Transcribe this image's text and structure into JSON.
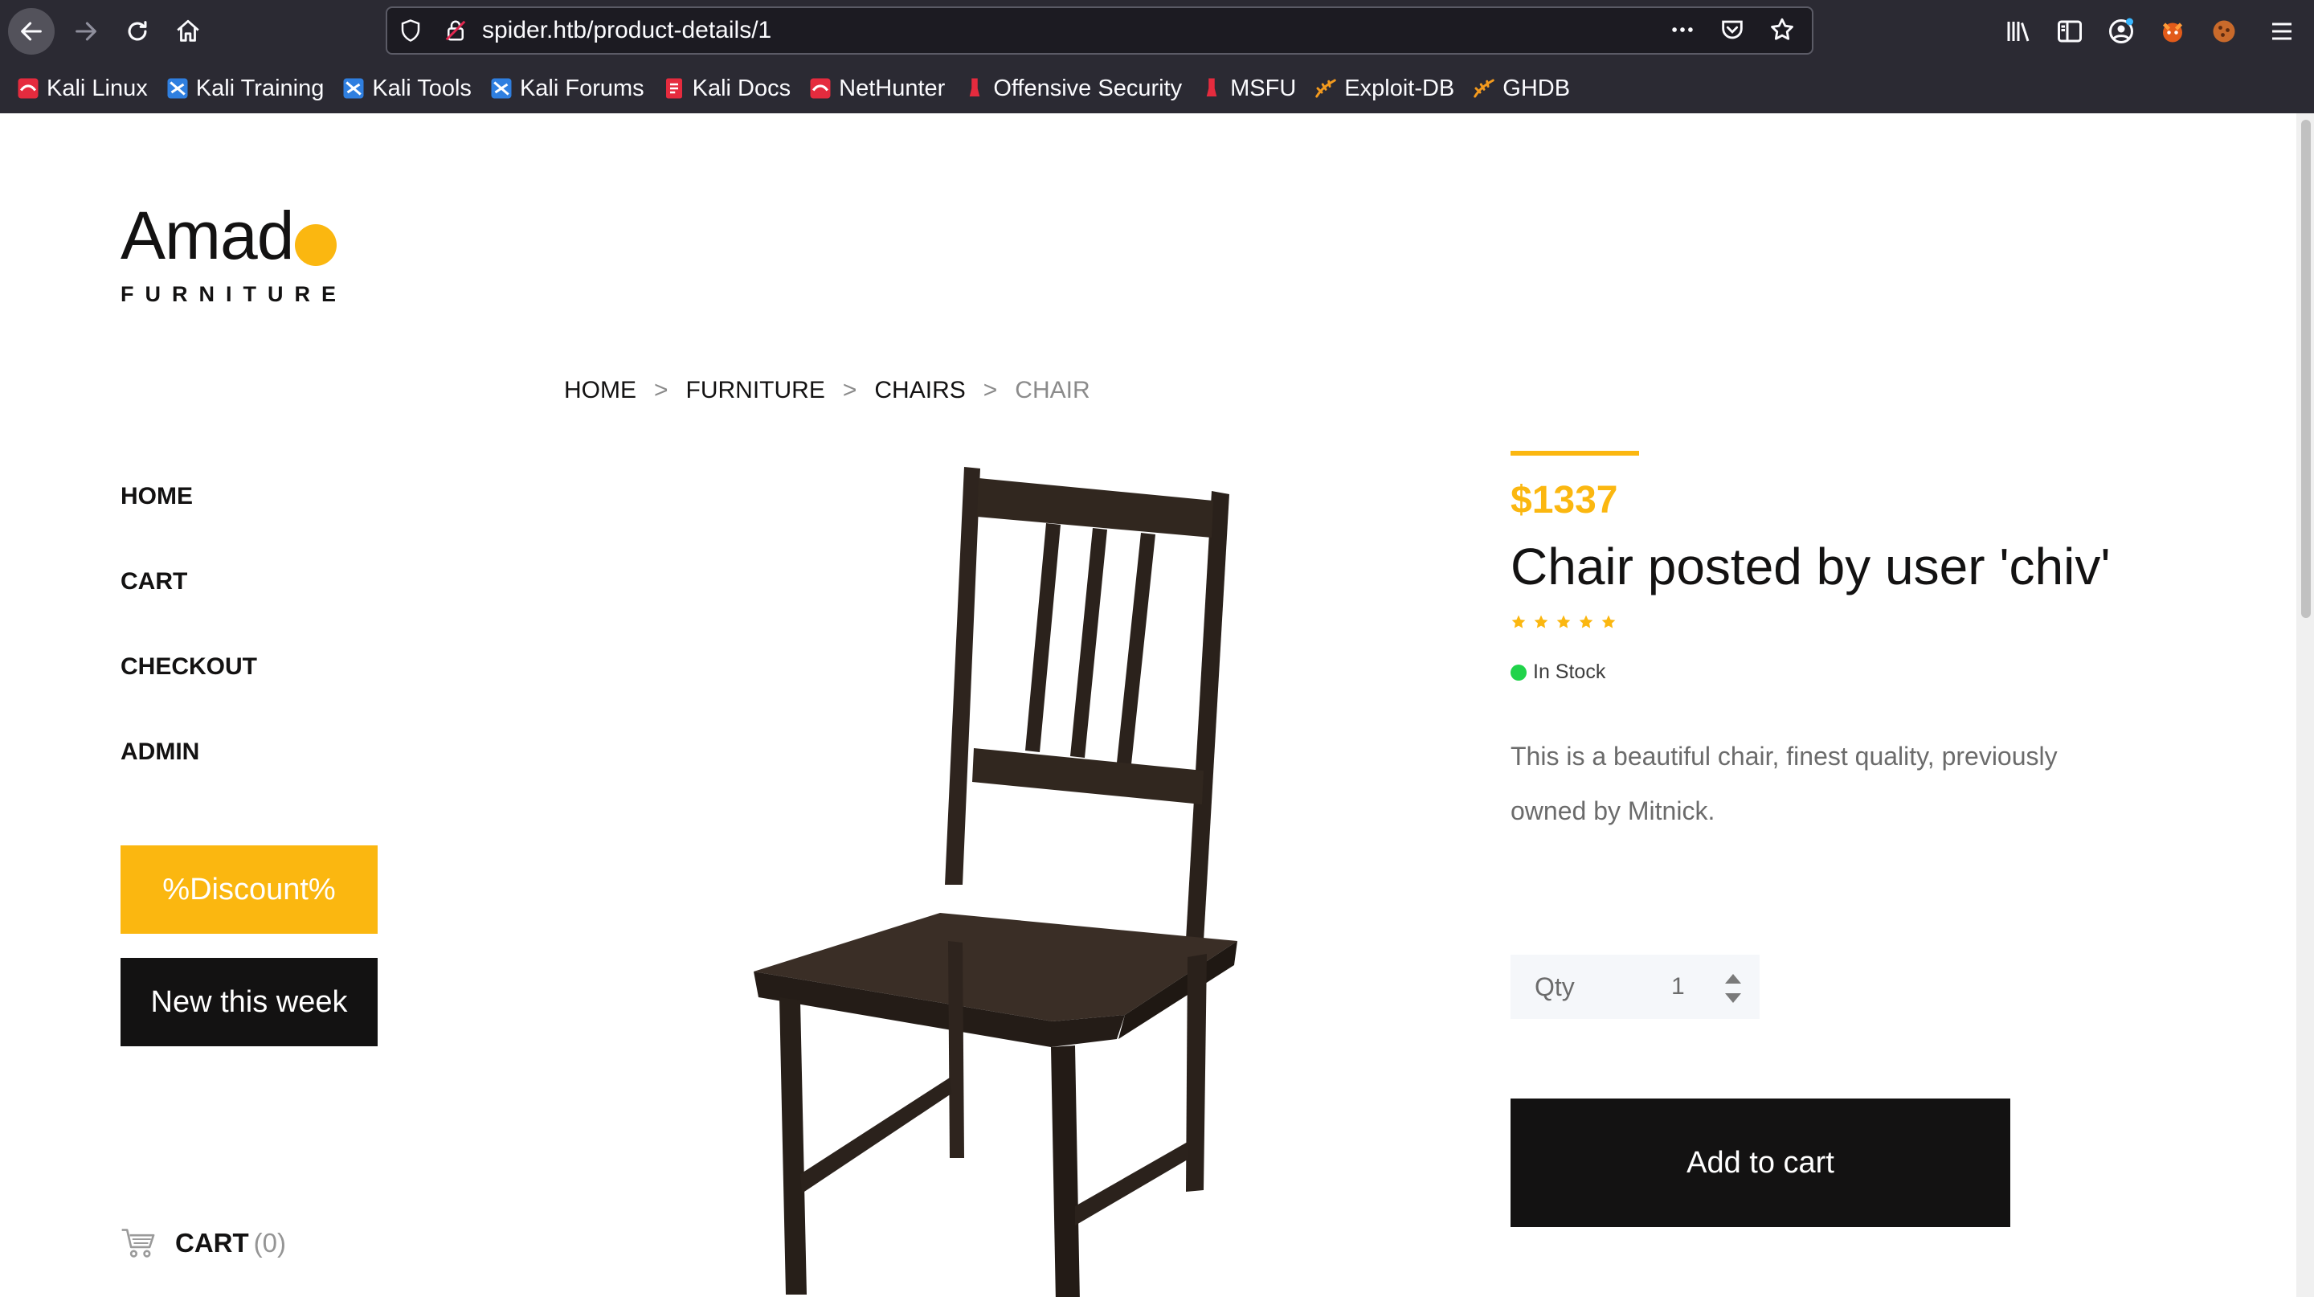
{
  "browser": {
    "url": "spider.htb/product-details/1",
    "bookmarks": [
      {
        "label": "Kali Linux",
        "icon": "kali-linux-icon"
      },
      {
        "label": "Kali Training",
        "icon": "kali-training-icon"
      },
      {
        "label": "Kali Tools",
        "icon": "kali-tools-icon"
      },
      {
        "label": "Kali Forums",
        "icon": "kali-forums-icon"
      },
      {
        "label": "Kali Docs",
        "icon": "kali-docs-icon"
      },
      {
        "label": "NetHunter",
        "icon": "nethunter-icon"
      },
      {
        "label": "Offensive Security",
        "icon": "offsec-icon"
      },
      {
        "label": "MSFU",
        "icon": "msfu-icon"
      },
      {
        "label": "Exploit-DB",
        "icon": "exploit-db-icon"
      },
      {
        "label": "GHDB",
        "icon": "ghdb-icon"
      }
    ]
  },
  "logo": {
    "main": "Amad",
    "sub": "FURNITURE"
  },
  "nav": {
    "items": [
      {
        "label": "HOME"
      },
      {
        "label": "CART"
      },
      {
        "label": "CHECKOUT"
      },
      {
        "label": "ADMIN"
      }
    ]
  },
  "promo": {
    "discount_label": "%Discount%",
    "new_label": "New this week"
  },
  "side_cart": {
    "label": "CART",
    "count": "(0)"
  },
  "breadcrumb": {
    "home": "HOME",
    "furniture": "FURNITURE",
    "chairs": "CHAIRS",
    "current": "CHAIR",
    "separator": ">"
  },
  "product": {
    "price": "$1337",
    "title": "Chair posted by user 'chiv'",
    "rating": 5,
    "stock": "In Stock",
    "description": "This is a beautiful chair, finest quality, previously owned by Mitnick.",
    "qty_label": "Qty",
    "qty_value": "1",
    "add_to_cart": "Add to cart"
  },
  "colors": {
    "accent": "#fbb710",
    "dark": "#131212",
    "in_stock": "#20d34a",
    "chrome": "#2b2a33"
  }
}
